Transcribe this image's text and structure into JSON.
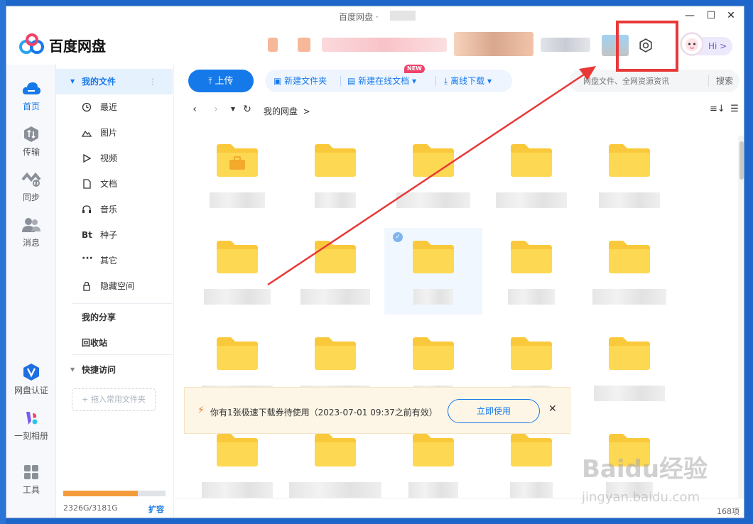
{
  "window": {
    "title": "百度网盘 ·",
    "controls": {
      "minimize": "—",
      "maximize": "☐",
      "close": "✕"
    }
  },
  "header": {
    "app_name": "百度网盘",
    "greeting": "Hi >",
    "settings_icon": "gear-icon"
  },
  "rail": {
    "items": [
      {
        "label": "首页",
        "icon": "cloud-icon"
      },
      {
        "label": "传输",
        "icon": "transfer-icon"
      },
      {
        "label": "同步",
        "icon": "sync-icon"
      },
      {
        "label": "消息",
        "icon": "message-icon"
      },
      {
        "label": "网盘认证",
        "icon": "verify-icon"
      },
      {
        "label": "一刻相册",
        "icon": "album-icon"
      },
      {
        "label": "工具",
        "icon": "tools-icon"
      }
    ]
  },
  "nav": {
    "my_files": "我的文件",
    "items": [
      {
        "label": "最近",
        "icon": "clock-icon"
      },
      {
        "label": "图片",
        "icon": "image-icon"
      },
      {
        "label": "视频",
        "icon": "video-icon"
      },
      {
        "label": "文档",
        "icon": "document-icon"
      },
      {
        "label": "音乐",
        "icon": "headphone-icon"
      },
      {
        "label": "种子",
        "icon": "bt-icon"
      },
      {
        "label": "其它",
        "icon": "more-icon"
      },
      {
        "label": "隐藏空间",
        "icon": "lock-icon"
      }
    ],
    "my_share": "我的分享",
    "recycle": "回收站",
    "quick_access": "快捷访问",
    "add_fav": "+ 拖入常用文件夹",
    "storage_text": "2326G/3181G",
    "storage_used": 2326,
    "storage_total": 3181,
    "expand": "扩容"
  },
  "toolbar": {
    "upload": "上传",
    "new_folder": "新建文件夹",
    "new_online_doc": "新建在线文档",
    "new_badge": "NEW",
    "offline_download": "离线下载",
    "search_placeholder": "网盘文件、全网资源资讯",
    "search_button": "搜索"
  },
  "path": {
    "crumb": "我的网盘",
    "crumb_sep": ">"
  },
  "status": {
    "count": "168项"
  },
  "toast": {
    "message": "你有1张极速下载券待使用（2023-07-01 09:37之前有效）",
    "action": "立即使用",
    "close": "✕"
  },
  "watermark": {
    "brand": "Baidu经验",
    "url": "jingyan.baidu.com"
  }
}
